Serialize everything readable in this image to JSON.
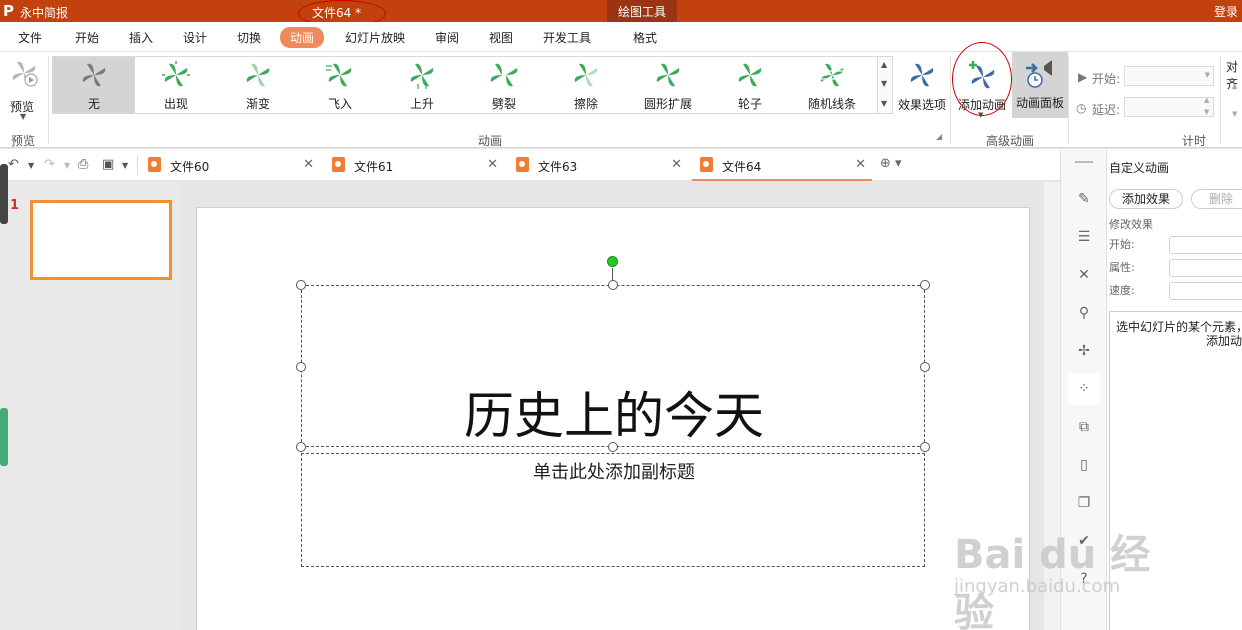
{
  "titlebar": {
    "app_name": "永中简报",
    "doc_title": "文件64 *",
    "context_tab": "绘图工具",
    "login": "登录"
  },
  "menu": {
    "tabs": [
      "文件",
      "开始",
      "插入",
      "设计",
      "切换",
      "动画",
      "幻灯片放映",
      "审阅",
      "视图",
      "开发工具",
      "格式"
    ],
    "active": "动画"
  },
  "ribbon": {
    "preview_label": "预览",
    "preview_group": "预览",
    "animations": [
      "无",
      "出现",
      "渐变",
      "飞入",
      "上升",
      "劈裂",
      "擦除",
      "圆形扩展",
      "轮子",
      "随机线条"
    ],
    "selected_animation": "无",
    "animation_group": "动画",
    "effect_options": "效果选项",
    "add_animation": "添加动画",
    "animation_pane": "动画面板",
    "advanced_group": "高级动画",
    "start_label": "开始:",
    "delay_label": "延迟:",
    "timing_group": "计时",
    "align_label": "对齐"
  },
  "doc_tabs": [
    {
      "name": "文件60"
    },
    {
      "name": "文件61"
    },
    {
      "name": "文件63"
    },
    {
      "name": "文件64"
    }
  ],
  "active_doc": "文件64",
  "slides": {
    "current_number": "1"
  },
  "slide": {
    "title": "历史上的今天",
    "subtitle": "单击此处添加副标题"
  },
  "custom_animation": {
    "title": "自定义动画",
    "add_effect": "添加效果",
    "delete": "删除",
    "modify_effect": "修改效果",
    "start": "开始:",
    "property": "属性:",
    "speed": "速度:",
    "hint_line1": "选中幻灯片的某个元素，",
    "hint_line2": "添加动画"
  },
  "watermark": {
    "brand": "Bai du 经验",
    "url": "jingyan.baidu.com"
  },
  "colors": {
    "accent": "#c2410c",
    "active_tab": "#f08a5d",
    "thumb_border": "#f0912f",
    "anim_green": "#3daa5b",
    "anim_blue": "#3a6ea5"
  }
}
